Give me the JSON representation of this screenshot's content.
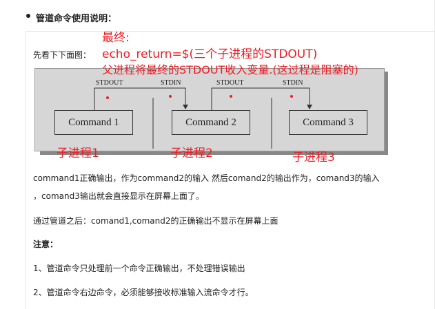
{
  "section": {
    "title": "管道命令使用说明："
  },
  "intro": "先看下下面图：",
  "annotations": {
    "final": "最终:",
    "echo": "echo_return=$(三个子进程的STDOUT)",
    "parent": "父进程将最终的STDOUT收入变量.(这过程是阻塞的)"
  },
  "diagram": {
    "labels": [
      "STDOUT",
      "STDIN",
      "STDOUT",
      "STDIN"
    ],
    "commands": [
      "Command 1",
      "Command 2",
      "Command 3"
    ],
    "processes": [
      "子进程1",
      "子进程2",
      "子进程3"
    ]
  },
  "paragraphs": {
    "p1_line1": "command1正确输出，作为command2的输入 然后comand2的输出作为，comand3的输入",
    "p1_line2": "，comand3输出就会直接显示在屏幕上面了。",
    "p2": "通过管道之后：comand1,comand2的正确输出不显示在屏幕上面",
    "note_title": "注意：",
    "note1": "1、管道命令只处理前一个命令正确输出，不处理错误输出",
    "note2": "2、管道命令右边命令，必须能够接收标准输入流命令才行。"
  },
  "colors": {
    "annotation": "#ee1c24",
    "diagram_bg": "#d6d6d6"
  }
}
